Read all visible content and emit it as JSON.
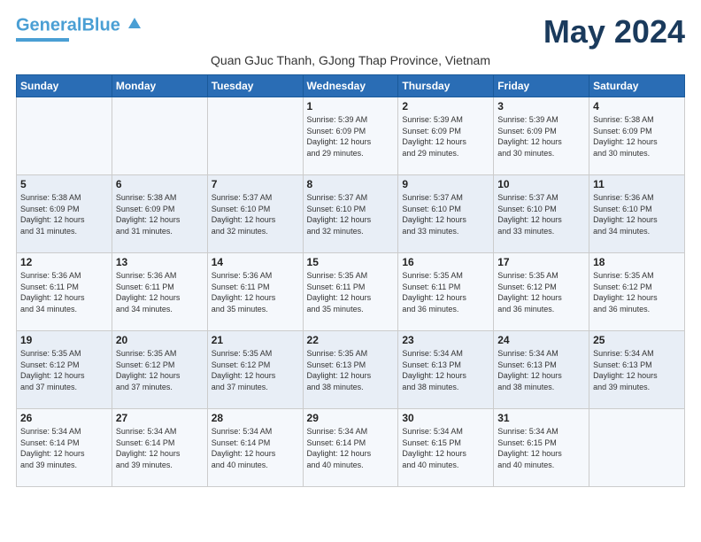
{
  "header": {
    "logo_general": "General",
    "logo_blue": "Blue",
    "month_title": "May 2024",
    "subtitle": "Quan GJuc Thanh, GJong Thap Province, Vietnam"
  },
  "days_of_week": [
    "Sunday",
    "Monday",
    "Tuesday",
    "Wednesday",
    "Thursday",
    "Friday",
    "Saturday"
  ],
  "weeks": [
    [
      {
        "day": "",
        "info": ""
      },
      {
        "day": "",
        "info": ""
      },
      {
        "day": "",
        "info": ""
      },
      {
        "day": "1",
        "info": "Sunrise: 5:39 AM\nSunset: 6:09 PM\nDaylight: 12 hours\nand 29 minutes."
      },
      {
        "day": "2",
        "info": "Sunrise: 5:39 AM\nSunset: 6:09 PM\nDaylight: 12 hours\nand 29 minutes."
      },
      {
        "day": "3",
        "info": "Sunrise: 5:39 AM\nSunset: 6:09 PM\nDaylight: 12 hours\nand 30 minutes."
      },
      {
        "day": "4",
        "info": "Sunrise: 5:38 AM\nSunset: 6:09 PM\nDaylight: 12 hours\nand 30 minutes."
      }
    ],
    [
      {
        "day": "5",
        "info": "Sunrise: 5:38 AM\nSunset: 6:09 PM\nDaylight: 12 hours\nand 31 minutes."
      },
      {
        "day": "6",
        "info": "Sunrise: 5:38 AM\nSunset: 6:09 PM\nDaylight: 12 hours\nand 31 minutes."
      },
      {
        "day": "7",
        "info": "Sunrise: 5:37 AM\nSunset: 6:10 PM\nDaylight: 12 hours\nand 32 minutes."
      },
      {
        "day": "8",
        "info": "Sunrise: 5:37 AM\nSunset: 6:10 PM\nDaylight: 12 hours\nand 32 minutes."
      },
      {
        "day": "9",
        "info": "Sunrise: 5:37 AM\nSunset: 6:10 PM\nDaylight: 12 hours\nand 33 minutes."
      },
      {
        "day": "10",
        "info": "Sunrise: 5:37 AM\nSunset: 6:10 PM\nDaylight: 12 hours\nand 33 minutes."
      },
      {
        "day": "11",
        "info": "Sunrise: 5:36 AM\nSunset: 6:10 PM\nDaylight: 12 hours\nand 34 minutes."
      }
    ],
    [
      {
        "day": "12",
        "info": "Sunrise: 5:36 AM\nSunset: 6:11 PM\nDaylight: 12 hours\nand 34 minutes."
      },
      {
        "day": "13",
        "info": "Sunrise: 5:36 AM\nSunset: 6:11 PM\nDaylight: 12 hours\nand 34 minutes."
      },
      {
        "day": "14",
        "info": "Sunrise: 5:36 AM\nSunset: 6:11 PM\nDaylight: 12 hours\nand 35 minutes."
      },
      {
        "day": "15",
        "info": "Sunrise: 5:35 AM\nSunset: 6:11 PM\nDaylight: 12 hours\nand 35 minutes."
      },
      {
        "day": "16",
        "info": "Sunrise: 5:35 AM\nSunset: 6:11 PM\nDaylight: 12 hours\nand 36 minutes."
      },
      {
        "day": "17",
        "info": "Sunrise: 5:35 AM\nSunset: 6:12 PM\nDaylight: 12 hours\nand 36 minutes."
      },
      {
        "day": "18",
        "info": "Sunrise: 5:35 AM\nSunset: 6:12 PM\nDaylight: 12 hours\nand 36 minutes."
      }
    ],
    [
      {
        "day": "19",
        "info": "Sunrise: 5:35 AM\nSunset: 6:12 PM\nDaylight: 12 hours\nand 37 minutes."
      },
      {
        "day": "20",
        "info": "Sunrise: 5:35 AM\nSunset: 6:12 PM\nDaylight: 12 hours\nand 37 minutes."
      },
      {
        "day": "21",
        "info": "Sunrise: 5:35 AM\nSunset: 6:12 PM\nDaylight: 12 hours\nand 37 minutes."
      },
      {
        "day": "22",
        "info": "Sunrise: 5:35 AM\nSunset: 6:13 PM\nDaylight: 12 hours\nand 38 minutes."
      },
      {
        "day": "23",
        "info": "Sunrise: 5:34 AM\nSunset: 6:13 PM\nDaylight: 12 hours\nand 38 minutes."
      },
      {
        "day": "24",
        "info": "Sunrise: 5:34 AM\nSunset: 6:13 PM\nDaylight: 12 hours\nand 38 minutes."
      },
      {
        "day": "25",
        "info": "Sunrise: 5:34 AM\nSunset: 6:13 PM\nDaylight: 12 hours\nand 39 minutes."
      }
    ],
    [
      {
        "day": "26",
        "info": "Sunrise: 5:34 AM\nSunset: 6:14 PM\nDaylight: 12 hours\nand 39 minutes."
      },
      {
        "day": "27",
        "info": "Sunrise: 5:34 AM\nSunset: 6:14 PM\nDaylight: 12 hours\nand 39 minutes."
      },
      {
        "day": "28",
        "info": "Sunrise: 5:34 AM\nSunset: 6:14 PM\nDaylight: 12 hours\nand 40 minutes."
      },
      {
        "day": "29",
        "info": "Sunrise: 5:34 AM\nSunset: 6:14 PM\nDaylight: 12 hours\nand 40 minutes."
      },
      {
        "day": "30",
        "info": "Sunrise: 5:34 AM\nSunset: 6:15 PM\nDaylight: 12 hours\nand 40 minutes."
      },
      {
        "day": "31",
        "info": "Sunrise: 5:34 AM\nSunset: 6:15 PM\nDaylight: 12 hours\nand 40 minutes."
      },
      {
        "day": "",
        "info": ""
      }
    ]
  ]
}
